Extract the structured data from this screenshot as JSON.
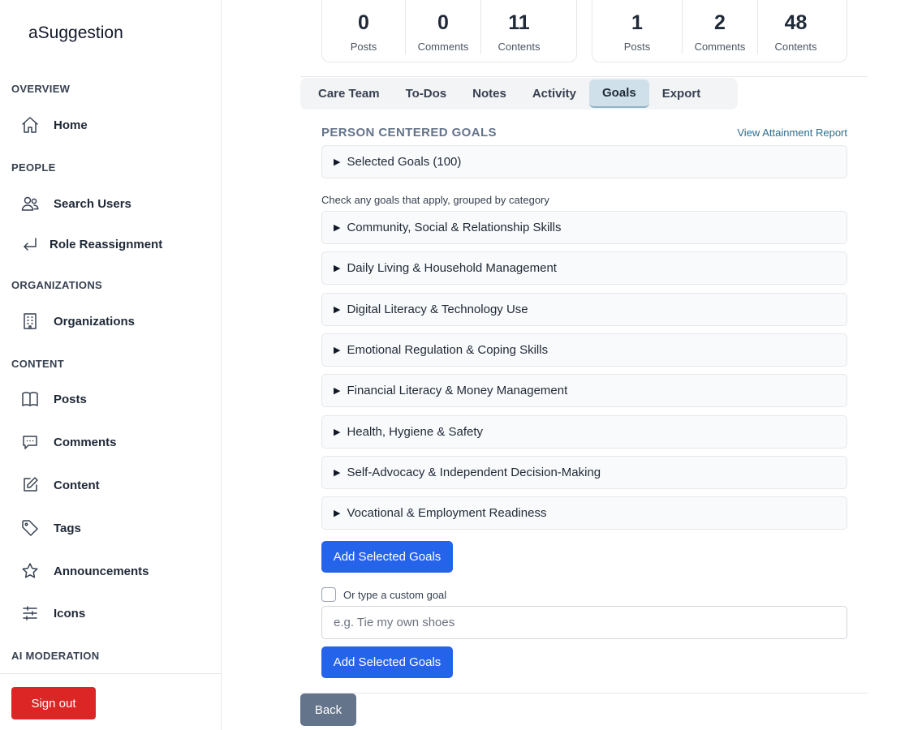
{
  "app": {
    "brand": "aSuggestion"
  },
  "sidebar": {
    "sections": {
      "overview": "OVERVIEW",
      "people": "PEOPLE",
      "organizations": "ORGANIZATIONS",
      "content": "CONTENT",
      "ai_moderation": "AI MODERATION"
    },
    "items": {
      "home": {
        "label": "Home",
        "icon": "home-icon"
      },
      "search_users": {
        "label": "Search Users",
        "icon": "users-icon"
      },
      "role_reassignment": {
        "label": "Role Reassignment",
        "icon": "return-arrow-icon"
      },
      "organizations": {
        "label": "Organizations",
        "icon": "building-icon"
      },
      "posts": {
        "label": "Posts",
        "icon": "book-icon"
      },
      "comments": {
        "label": "Comments",
        "icon": "chat-bubble-icon"
      },
      "content": {
        "label": "Content",
        "icon": "edit-icon"
      },
      "tags": {
        "label": "Tags",
        "icon": "tag-icon"
      },
      "announcements": {
        "label": "Announcements",
        "icon": "star-icon"
      },
      "icons": {
        "label": "Icons",
        "icon": "sliders-icon"
      }
    },
    "sign_out": "Sign out"
  },
  "stats": {
    "left": [
      {
        "value": "0",
        "label": "Posts"
      },
      {
        "value": "0",
        "label": "Comments"
      },
      {
        "value": "11",
        "label": "Contents"
      }
    ],
    "right": [
      {
        "value": "1",
        "label": "Posts"
      },
      {
        "value": "2",
        "label": "Comments"
      },
      {
        "value": "48",
        "label": "Contents"
      }
    ]
  },
  "tabs": [
    {
      "label": "Care Team",
      "active": false
    },
    {
      "label": "To-Dos",
      "active": false
    },
    {
      "label": "Notes",
      "active": false
    },
    {
      "label": "Activity",
      "active": false
    },
    {
      "label": "Goals",
      "active": true
    },
    {
      "label": "Export",
      "active": false
    }
  ],
  "goals": {
    "title": "PERSON CENTERED GOALS",
    "attainment_link": "View Attainment Report",
    "selected": "Selected Goals (100)",
    "hint": "Check any goals that apply, grouped by category",
    "categories": [
      "Community, Social & Relationship Skills",
      "Daily Living & Household Management",
      "Digital Literacy & Technology Use",
      "Emotional Regulation & Coping Skills",
      "Financial Literacy & Money Management",
      "Health, Hygiene & Safety",
      "Self-Advocacy & Independent Decision-Making",
      "Vocational & Employment Readiness"
    ],
    "add_button": "Add Selected Goals",
    "custom_label": "Or type a custom goal",
    "custom_placeholder": "e.g. Tie my own shoes",
    "add_button_2": "Add Selected Goals"
  },
  "back_button": "Back",
  "colors": {
    "primary": "#2563eb",
    "danger": "#dc2626",
    "back": "#64748b",
    "active_tab": "#cfe0ea"
  }
}
